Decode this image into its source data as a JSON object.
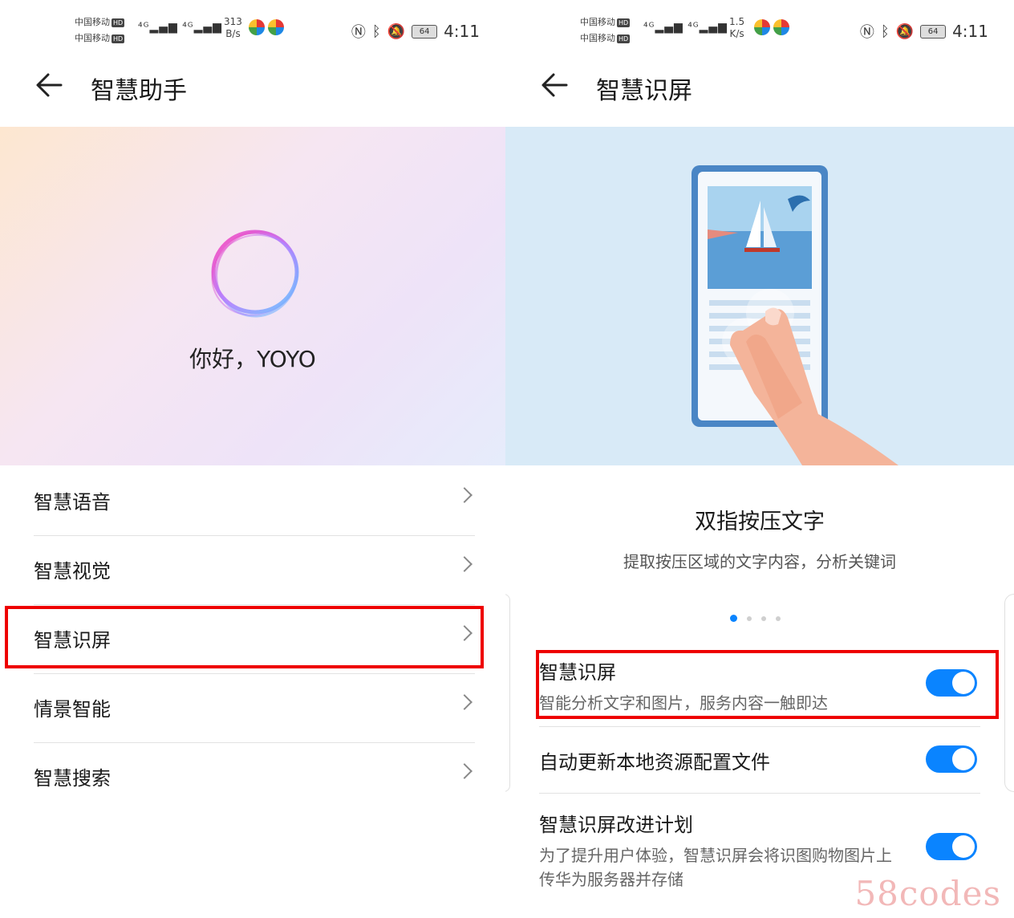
{
  "left": {
    "status": {
      "carrier1": "中国移动",
      "carrier2": "中国移动",
      "hd": "HD",
      "signal": "⁴ᴳ▂▄▆ ⁴ᴳ▂▄▆",
      "speed_value": "313",
      "speed_unit": "B/s",
      "battery": "64",
      "time": "4:11"
    },
    "title": "智慧助手",
    "greeting": "你好，YOYO",
    "menu": [
      {
        "label": "智慧语音"
      },
      {
        "label": "智慧视觉"
      },
      {
        "label": "智慧识屏"
      },
      {
        "label": "情景智能"
      },
      {
        "label": "智慧搜索"
      }
    ]
  },
  "right": {
    "status": {
      "carrier1": "中国移动",
      "carrier2": "中国移动",
      "hd": "HD",
      "signal": "⁴ᴳ▂▄▆ ⁴ᴳ▂▄▆",
      "speed_value": "1.5",
      "speed_unit": "K/s",
      "battery": "64",
      "time": "4:11"
    },
    "title": "智慧识屏",
    "carousel": {
      "title": "双指按压文字",
      "desc": "提取按压区域的文字内容，分析关键词",
      "page_count": 4,
      "active_index": 0
    },
    "settings": [
      {
        "label": "智慧识屏",
        "desc": "智能分析文字和图片，服务内容一触即达",
        "enabled": true
      },
      {
        "label": "自动更新本地资源配置文件",
        "desc": "",
        "enabled": true
      },
      {
        "label": "智慧识屏改进计划",
        "desc": "为了提升用户体验，智慧识屏会将识图购物图片上传华为服务器并存储",
        "enabled": true
      }
    ]
  },
  "colors": {
    "accent": "#0a84ff",
    "highlight": "#e00000"
  },
  "watermark": "58codes"
}
